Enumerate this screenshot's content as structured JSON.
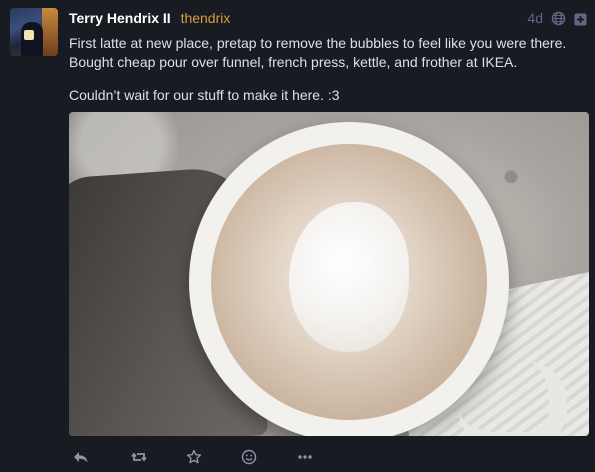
{
  "status": {
    "author": {
      "display_name": "Terry Hendrix II",
      "acct": "thendrix"
    },
    "time": "4d",
    "visibility_icon": "globe-icon",
    "content": [
      "First latte at new place, pretap to remove the bubbles to feel like you were there. Bought cheap pour over funnel, french press, kettle, and frother at IKEA.",
      "Couldn’t wait for our stuff to make it here. :3"
    ],
    "media": {
      "kind": "photo",
      "subject": "latte in white cup"
    },
    "actions": [
      {
        "name": "reply",
        "icon": "reply-icon"
      },
      {
        "name": "boost",
        "icon": "boost-icon"
      },
      {
        "name": "favourite",
        "icon": "star-icon"
      },
      {
        "name": "react",
        "icon": "emoji-icon"
      },
      {
        "name": "more",
        "icon": "more-icon"
      }
    ]
  },
  "colors": {
    "background": "#191b22",
    "text": "#d9e1e8",
    "accent": "#d59e3f",
    "muted": "#606984",
    "action_icons": "#8d95a8"
  }
}
